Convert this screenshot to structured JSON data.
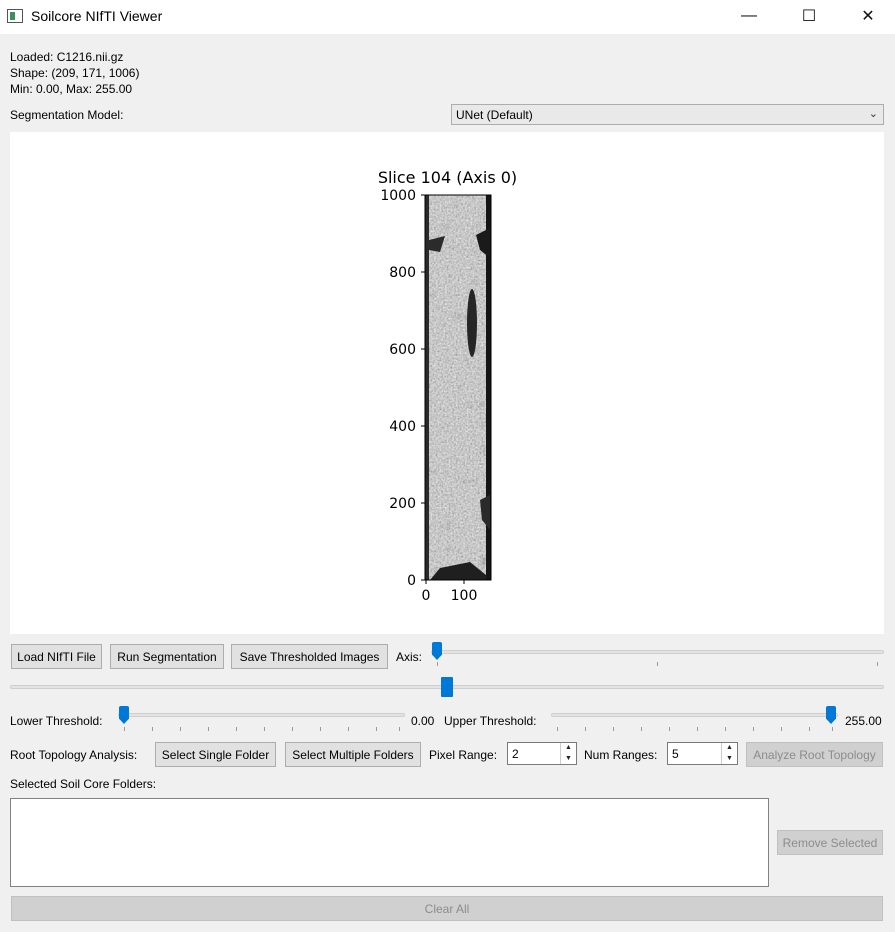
{
  "window": {
    "title": "Soilcore NIfTI Viewer",
    "minimize_glyph": "—",
    "maximize_glyph": "☐",
    "close_glyph": "✕"
  },
  "info": {
    "loaded": "Loaded: C1216.nii.gz",
    "shape": "Shape: (209, 171, 1006)",
    "minmax": "Min: 0.00, Max: 255.00"
  },
  "segmentation": {
    "label": "Segmentation Model:",
    "selected": "UNet (Default)"
  },
  "plot": {
    "title": "Slice 104 (Axis 0)",
    "y_ticks": [
      "1000",
      "800",
      "600",
      "400",
      "200",
      "0"
    ],
    "x_ticks": [
      "0",
      "100"
    ]
  },
  "chart_data": {
    "type": "heatmap",
    "title": "Slice 104 (Axis 0)",
    "xlim": [
      0,
      171
    ],
    "ylim": [
      0,
      1006
    ],
    "x_ticks": [
      0,
      100
    ],
    "y_ticks": [
      0,
      200,
      400,
      600,
      800,
      1000
    ],
    "colormap": "gray"
  },
  "toolbar": {
    "load_label": "Load NIfTI File",
    "run_label": "Run Segmentation",
    "save_label": "Save Thresholded Images",
    "axis_label": "Axis:",
    "axis_value": 0,
    "axis_max": 2
  },
  "slice_slider": {
    "fraction": 0.5
  },
  "threshold": {
    "lower_label": "Lower Threshold:",
    "lower_value": "0.00",
    "upper_label": "Upper Threshold:",
    "upper_value": "255.00",
    "lower_fraction": 0.0,
    "upper_fraction": 1.0
  },
  "topology": {
    "label": "Root Topology Analysis:",
    "single_label": "Select Single Folder",
    "multiple_label": "Select Multiple Folders",
    "pixel_range_label": "Pixel Range:",
    "pixel_range_value": "2",
    "num_ranges_label": "Num Ranges:",
    "num_ranges_value": "5",
    "analyze_label": "Analyze Root Topology"
  },
  "folders": {
    "label": "Selected Soil Core Folders:",
    "remove_label": "Remove Selected",
    "clear_label": "Clear All"
  },
  "colors": {
    "accent": "#0078d7",
    "window_bg": "#f0f0f0"
  }
}
